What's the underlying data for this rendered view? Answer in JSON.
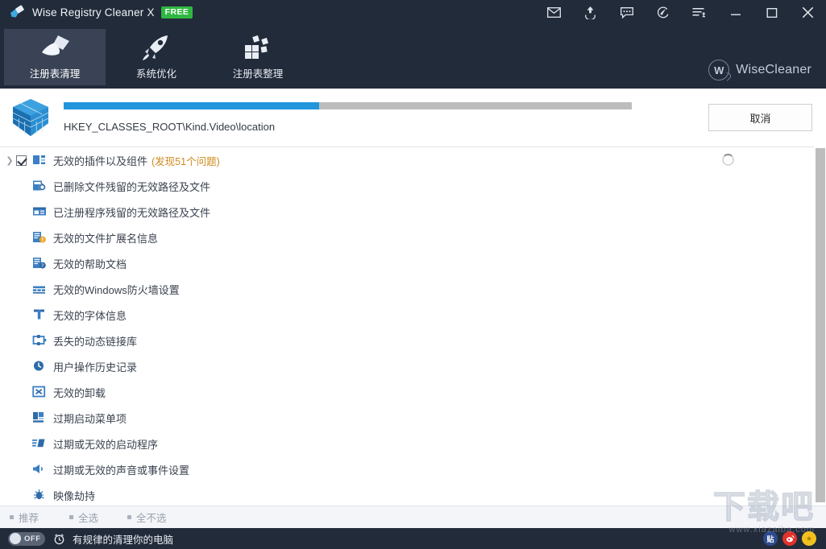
{
  "titlebar": {
    "app_icon": "brush-icon",
    "title": "Wise Registry Cleaner X",
    "badge": "FREE",
    "buttons": [
      {
        "name": "mail-icon",
        "label": ""
      },
      {
        "name": "upgrade-icon",
        "label": ""
      },
      {
        "name": "feedback-icon",
        "label": ""
      },
      {
        "name": "help-icon",
        "label": ""
      },
      {
        "name": "menu-icon",
        "label": ""
      },
      {
        "name": "minimize-button",
        "label": ""
      },
      {
        "name": "maximize-button",
        "label": ""
      },
      {
        "name": "close-button",
        "label": ""
      }
    ]
  },
  "nav": {
    "tabs": [
      {
        "label": "注册表清理",
        "icon": "brush-icon",
        "active": true
      },
      {
        "label": "系统优化",
        "icon": "rocket-icon",
        "active": false
      },
      {
        "label": "注册表整理",
        "icon": "blocks-icon",
        "active": false
      }
    ],
    "brand_mark": "W",
    "brand_name": "WiseCleaner"
  },
  "scan": {
    "icon": "cube-icon",
    "progress_percent": 45,
    "current_path": "HKEY_CLASSES_ROOT\\Kind.Video\\location",
    "cancel_label": "取消",
    "spinner": "loading-spinner"
  },
  "list": {
    "rows": [
      {
        "label": "无效的插件以及组件",
        "count": "(发现51个问题)",
        "icon": "plugin-icon",
        "checkbox": true,
        "checked": true,
        "expandable": true,
        "spinner": true
      },
      {
        "label": "已删除文件残留的无效路径及文件",
        "count": "",
        "icon": "deleted-file-icon",
        "checkbox": false,
        "checked": false,
        "expandable": false,
        "spinner": false
      },
      {
        "label": "已注册程序残留的无效路径及文件",
        "count": "",
        "icon": "registered-program-icon",
        "checkbox": false,
        "checked": false,
        "expandable": false,
        "spinner": false
      },
      {
        "label": "无效的文件扩展名信息",
        "count": "",
        "icon": "file-ext-warning-icon",
        "checkbox": false,
        "checked": false,
        "expandable": false,
        "spinner": false
      },
      {
        "label": "无效的帮助文档",
        "count": "",
        "icon": "help-doc-icon",
        "checkbox": false,
        "checked": false,
        "expandable": false,
        "spinner": false
      },
      {
        "label": "无效的Windows防火墙设置",
        "count": "",
        "icon": "firewall-icon",
        "checkbox": false,
        "checked": false,
        "expandable": false,
        "spinner": false
      },
      {
        "label": "无效的字体信息",
        "count": "",
        "icon": "font-icon",
        "checkbox": false,
        "checked": false,
        "expandable": false,
        "spinner": false
      },
      {
        "label": "丢失的动态链接库",
        "count": "",
        "icon": "dll-icon",
        "checkbox": false,
        "checked": false,
        "expandable": false,
        "spinner": false
      },
      {
        "label": "用户操作历史记录",
        "count": "",
        "icon": "history-clock-icon",
        "checkbox": false,
        "checked": false,
        "expandable": false,
        "spinner": false
      },
      {
        "label": "无效的卸载",
        "count": "",
        "icon": "uninstall-icon",
        "checkbox": false,
        "checked": false,
        "expandable": false,
        "spinner": false
      },
      {
        "label": "过期启动菜单项",
        "count": "",
        "icon": "start-menu-icon",
        "checkbox": false,
        "checked": false,
        "expandable": false,
        "spinner": false
      },
      {
        "label": "过期或无效的启动程序",
        "count": "",
        "icon": "startup-program-icon",
        "checkbox": false,
        "checked": false,
        "expandable": false,
        "spinner": false
      },
      {
        "label": "过期或无效的声音或事件设置",
        "count": "",
        "icon": "sound-icon",
        "checkbox": false,
        "checked": false,
        "expandable": false,
        "spinner": false
      },
      {
        "label": "映像劫持",
        "count": "",
        "icon": "image-hijack-icon",
        "checkbox": false,
        "checked": false,
        "expandable": false,
        "spinner": false
      }
    ]
  },
  "actions": [
    {
      "label": "推荐",
      "name": "recommend-link"
    },
    {
      "label": "全选",
      "name": "select-all-link"
    },
    {
      "label": "全不选",
      "name": "select-none-link"
    }
  ],
  "status": {
    "toggle_state": "OFF",
    "clock_icon": "alarm-clock-icon",
    "text": "有规律的清理你的电脑",
    "social": [
      {
        "name": "tieba-icon",
        "glyph": "贴"
      },
      {
        "name": "weibo-icon",
        "glyph": ""
      },
      {
        "name": "star-icon",
        "glyph": "★"
      }
    ]
  },
  "watermark": {
    "big": "下载吧",
    "small": "www.xiazaiba.com"
  },
  "colors": {
    "header": "#222b3a",
    "active_tab": "#394355",
    "progress_fill": "#2196dd",
    "progress_track": "#bdbdbd",
    "accent_orange": "#d08a1e",
    "badge_green": "#2fb742"
  }
}
